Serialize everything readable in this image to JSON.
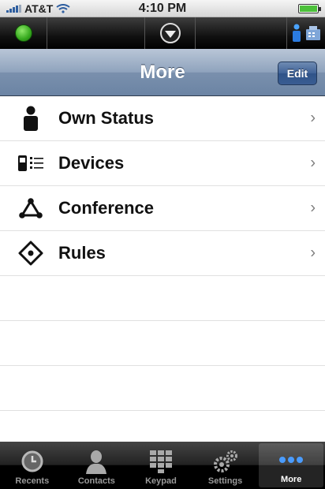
{
  "status_bar": {
    "carrier": "AT&T",
    "time": "4:10 PM",
    "icons": [
      "signal-bars-icon",
      "wifi-icon",
      "battery-icon"
    ]
  },
  "toolbar": {
    "icons": [
      "presence-status-icon",
      "dropdown-menu-icon",
      "desk-phone-icon"
    ],
    "presence_color": "#35a81d"
  },
  "nav": {
    "title": "More",
    "edit_label": "Edit"
  },
  "menu": {
    "items": [
      {
        "label": "Own Status",
        "icon": "person-icon"
      },
      {
        "label": "Devices",
        "icon": "devices-list-icon"
      },
      {
        "label": "Conference",
        "icon": "conference-triangle-icon"
      },
      {
        "label": "Rules",
        "icon": "rules-diamond-icon"
      }
    ]
  },
  "tabs": [
    {
      "label": "Recents",
      "icon": "clock-icon"
    },
    {
      "label": "Contacts",
      "icon": "contact-silhouette-icon"
    },
    {
      "label": "Keypad",
      "icon": "keypad-icon"
    },
    {
      "label": "Settings",
      "icon": "gears-icon"
    },
    {
      "label": "More",
      "icon": "more-dots-icon"
    }
  ],
  "colors": {
    "nav_bar": "#7a90ad",
    "edit_button": "#3f6297",
    "tab_bar": "#000000"
  }
}
